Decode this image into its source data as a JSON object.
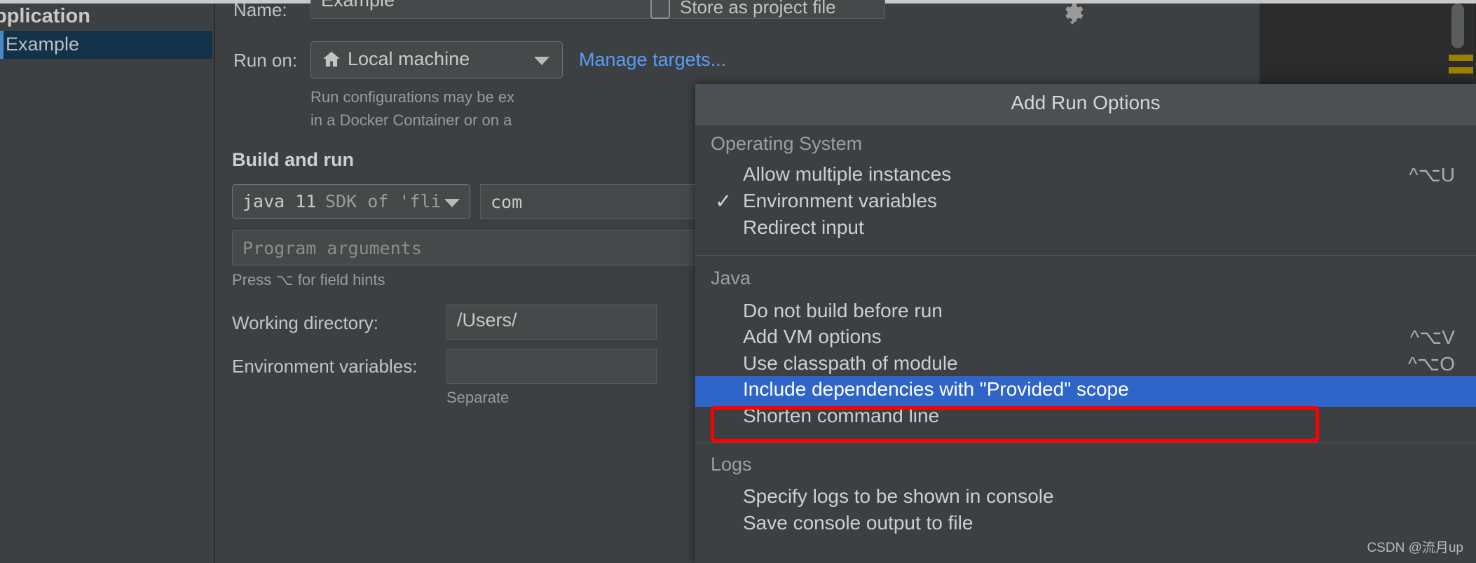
{
  "left_pane": {
    "group_label": "pplication",
    "selected_item": "Example"
  },
  "form": {
    "name_label": "Name:",
    "name_value": "Example",
    "store_as_project_file_label": "Store as project file",
    "store_as_project_file_checked": false,
    "gear_icon": "gear-dropdown-icon",
    "run_on_label": "Run on:",
    "run_on_value": "Local machine",
    "run_on_icon": "home-icon",
    "manage_targets_link": "Manage targets...",
    "description_line1": "Run configurations may be ex",
    "description_line2": "in a Docker Container or on a",
    "build_and_run_title": "Build and run",
    "jdk_value_bold": "java 11",
    "jdk_value_dim": "SDK of 'fli",
    "main_class_value": "com",
    "program_arguments_placeholder": "Program arguments",
    "field_hints_text": "Press ⌥ for field hints",
    "working_directory_label": "Working directory:",
    "working_directory_value": "/Users/",
    "environment_variables_label": "Environment variables:",
    "environment_variables_value": "",
    "separate_hint": "Separate "
  },
  "menu": {
    "title": "Add Run Options",
    "groups": [
      {
        "name": "Operating System",
        "items": [
          {
            "label": "Allow multiple instances",
            "shortcut": "^⌥U",
            "checked": false,
            "selected": false
          },
          {
            "label": "Environment variables",
            "shortcut": "",
            "checked": true,
            "selected": false
          },
          {
            "label": "Redirect input",
            "shortcut": "",
            "checked": false,
            "selected": false
          }
        ]
      },
      {
        "name": "Java",
        "items": [
          {
            "label": "Do not build before run",
            "shortcut": "",
            "checked": false,
            "selected": false
          },
          {
            "label": "Add VM options",
            "shortcut": "^⌥V",
            "checked": false,
            "selected": false
          },
          {
            "label": "Use classpath of module",
            "shortcut": "^⌥O",
            "checked": false,
            "selected": false
          },
          {
            "label": "Include dependencies with \"Provided\" scope",
            "shortcut": "",
            "checked": false,
            "selected": true
          },
          {
            "label": "Shorten command line",
            "shortcut": "",
            "checked": false,
            "selected": false
          }
        ]
      },
      {
        "name": "Logs",
        "items": [
          {
            "label": "Specify logs to be shown in console",
            "shortcut": "",
            "checked": false,
            "selected": false
          },
          {
            "label": "Save console output to file",
            "shortcut": "",
            "checked": false,
            "selected": false
          }
        ]
      }
    ],
    "check_glyph": "✓"
  },
  "colors": {
    "panel_bg": "#3c4043",
    "editor_bg": "#2b2b2b",
    "selection_blue": "#2f65c9",
    "tree_selection": "#12324a",
    "link_blue": "#589df6",
    "annotation_red": "#ff0000",
    "menu_header_bg": "#4c5052"
  },
  "watermark": "CSDN @流月up"
}
